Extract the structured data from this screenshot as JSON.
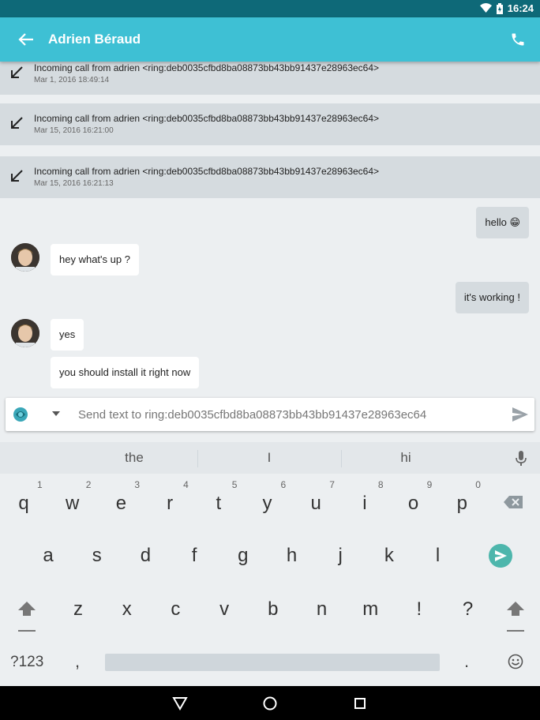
{
  "status_bar": {
    "time": "16:24"
  },
  "app_bar": {
    "title": "Adrien Béraud"
  },
  "calls": [
    {
      "text": "Incoming call from adrien  <ring:deb0035cfbd8ba08873bb43bb91437e28963ec64>",
      "date": "Mar 1, 2016 18:49:14"
    },
    {
      "text": "Incoming call from adrien  <ring:deb0035cfbd8ba08873bb43bb91437e28963ec64>",
      "date": "Mar 15, 2016 16:21:00"
    },
    {
      "text": "Incoming call from adrien  <ring:deb0035cfbd8ba08873bb43bb91437e28963ec64>",
      "date": "Mar 15, 2016 16:21:13"
    }
  ],
  "messages": {
    "m1": "hello 😁",
    "m2": "hey what's up ?",
    "m3": "it's working !",
    "m4": "yes",
    "m5": "you should install it right now"
  },
  "composer": {
    "placeholder": "Send text to ring:deb0035cfbd8ba08873bb43bb91437e28963ec64"
  },
  "keyboard": {
    "suggestions": [
      "the",
      "I",
      "hi"
    ],
    "row1": [
      "q",
      "w",
      "e",
      "r",
      "t",
      "y",
      "u",
      "i",
      "o",
      "p"
    ],
    "row1_hints": [
      "1",
      "2",
      "3",
      "4",
      "5",
      "6",
      "7",
      "8",
      "9",
      "0"
    ],
    "row2": [
      "a",
      "s",
      "d",
      "f",
      "g",
      "h",
      "j",
      "k",
      "l"
    ],
    "row3": [
      "z",
      "x",
      "c",
      "v",
      "b",
      "n",
      "m",
      "!",
      "?"
    ],
    "symbols_label": "?123",
    "comma": ",",
    "period": "."
  }
}
